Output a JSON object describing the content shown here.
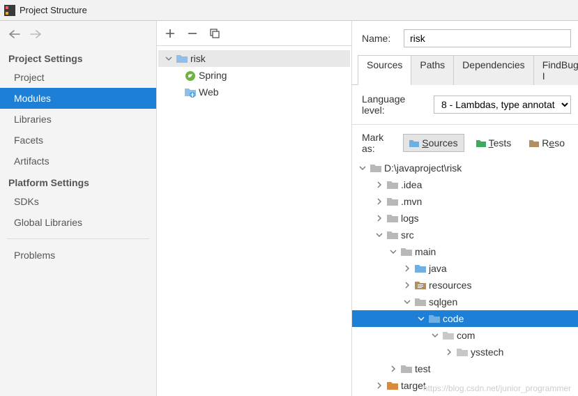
{
  "window": {
    "title": "Project Structure"
  },
  "sidebar": {
    "project_settings_header": "Project Settings",
    "platform_settings_header": "Platform Settings",
    "items": [
      {
        "label": "Project"
      },
      {
        "label": "Modules"
      },
      {
        "label": "Libraries"
      },
      {
        "label": "Facets"
      },
      {
        "label": "Artifacts"
      }
    ],
    "platform_items": [
      {
        "label": "SDKs"
      },
      {
        "label": "Global Libraries"
      }
    ],
    "problems_label": "Problems"
  },
  "center_tree": {
    "root": {
      "label": "risk"
    },
    "children": [
      {
        "label": "Spring",
        "icon": "spring"
      },
      {
        "label": "Web",
        "icon": "web"
      }
    ]
  },
  "right": {
    "name_label": "Name:",
    "name_value": "risk",
    "tabs": [
      {
        "label": "Sources"
      },
      {
        "label": "Paths"
      },
      {
        "label": "Dependencies"
      },
      {
        "label": "FindBugs-I"
      }
    ],
    "lang_label": "Language level:",
    "lang_value": "8 - Lambdas, type annotat",
    "mark_label": "Mark as:",
    "marks": [
      {
        "label": "Sources",
        "color": "#6db1e4"
      },
      {
        "label": "Tests",
        "color": "#41a85f"
      },
      {
        "label": "Reso",
        "color": "#b09060"
      }
    ],
    "tree": {
      "root": "D:\\javaproject\\risk",
      "nodes": {
        "idea": ".idea",
        "mvn": ".mvn",
        "logs": "logs",
        "src": "src",
        "main": "main",
        "java": "java",
        "resources": "resources",
        "sqlgen": "sqlgen",
        "code": "code",
        "com": "com",
        "ysstech": "ysstech",
        "test": "test",
        "target": "target"
      }
    }
  },
  "watermark": "https://blog.csdn.net/junior_programmer"
}
